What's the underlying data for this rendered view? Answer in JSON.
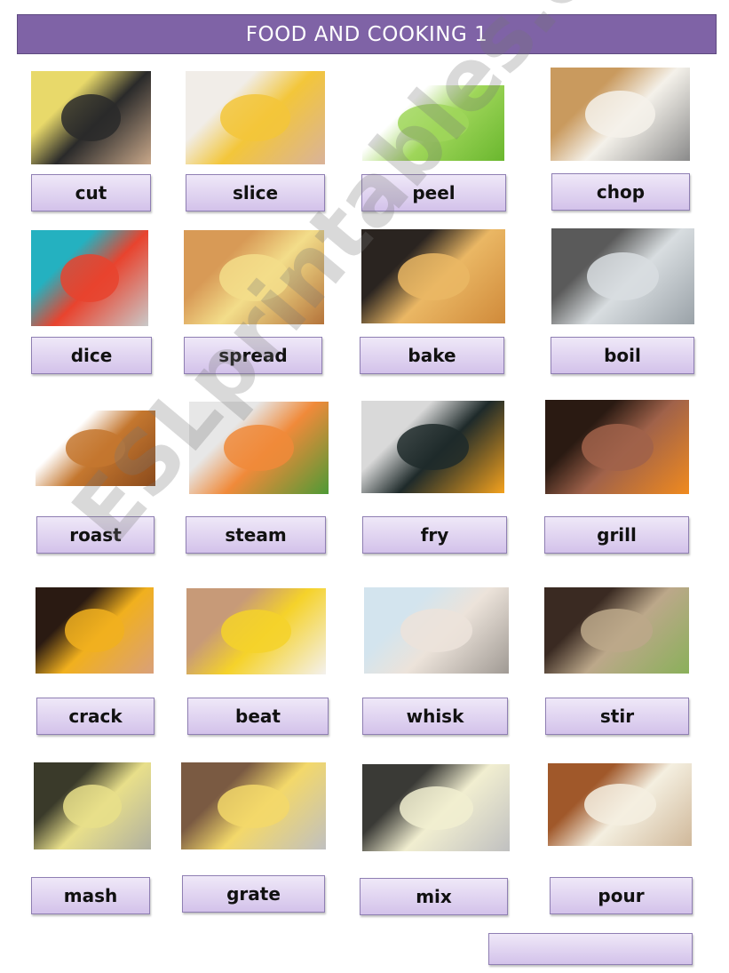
{
  "title": "FOOD AND COOKING 1",
  "watermark": "ESLprintables.com",
  "cards": [
    {
      "label": "cut",
      "image": "cutting-potato-photo",
      "colors": [
        "#e8d96a",
        "#2a2a2a",
        "#c9a88a"
      ]
    },
    {
      "label": "slice",
      "image": "slicing-lemon-photo",
      "colors": [
        "#f1ede8",
        "#f3c63a",
        "#d9b39a"
      ]
    },
    {
      "label": "peel",
      "image": "peeling-apple-photo",
      "colors": [
        "#ffffff",
        "#9fd65a",
        "#6ab72e"
      ]
    },
    {
      "label": "chop",
      "image": "chopping-onion-photo",
      "colors": [
        "#c99a5e",
        "#f4f1ea",
        "#8a8a8a"
      ]
    },
    {
      "label": "dice",
      "image": "dicing-tomato-photo",
      "colors": [
        "#24b1c0",
        "#e8432e",
        "#c9c9c9"
      ]
    },
    {
      "label": "spread",
      "image": "spreading-butter-photo",
      "colors": [
        "#d89a56",
        "#f3dd8a",
        "#b4733a"
      ]
    },
    {
      "label": "bake",
      "image": "baking-pie-photo",
      "colors": [
        "#2a2420",
        "#eab764",
        "#d08a3a"
      ]
    },
    {
      "label": "boil",
      "image": "boiling-pot-photo",
      "colors": [
        "#5a5a5a",
        "#d8dde0",
        "#9aa2a8"
      ]
    },
    {
      "label": "roast",
      "image": "roast-chicken-photo",
      "colors": [
        "#ffffff",
        "#c4772f",
        "#8a4a1c"
      ]
    },
    {
      "label": "steam",
      "image": "steamed-vegetables-photo",
      "colors": [
        "#e7e7e7",
        "#f08a3a",
        "#4e9a36"
      ]
    },
    {
      "label": "fry",
      "image": "frying-eggs-photo",
      "colors": [
        "#d9d9d9",
        "#1e2a2a",
        "#f4a21e"
      ]
    },
    {
      "label": "grill",
      "image": "grilling-burgers-photo",
      "colors": [
        "#2a1a12",
        "#a0624a",
        "#f08a1e"
      ]
    },
    {
      "label": "crack",
      "image": "cracking-egg-photo",
      "colors": [
        "#2a1a12",
        "#f1b01e",
        "#d9a07a"
      ]
    },
    {
      "label": "beat",
      "image": "beating-eggs-photo",
      "colors": [
        "#c79a78",
        "#f5d22a",
        "#f4f1ee"
      ]
    },
    {
      "label": "whisk",
      "image": "whisking-flour-photo",
      "colors": [
        "#d3e4ee",
        "#ece3da",
        "#a09a94"
      ]
    },
    {
      "label": "stir",
      "image": "stirring-pot-photo",
      "colors": [
        "#3a2a22",
        "#bca88a",
        "#8ab05a"
      ]
    },
    {
      "label": "mash",
      "image": "mashing-potatoes-photo",
      "colors": [
        "#3a3a2a",
        "#e8df8a",
        "#b0b0a0"
      ]
    },
    {
      "label": "grate",
      "image": "grating-cheese-photo",
      "colors": [
        "#7a5a42",
        "#f3d86a",
        "#c0c0c0"
      ]
    },
    {
      "label": "mix",
      "image": "mixing-batter-photo",
      "colors": [
        "#3a3a36",
        "#f1eed0",
        "#c0c0c0"
      ]
    },
    {
      "label": "pour",
      "image": "pouring-cream-photo",
      "colors": [
        "#a0582a",
        "#f4efe0",
        "#d0b89a"
      ]
    }
  ],
  "extra_box": {
    "label": ""
  }
}
